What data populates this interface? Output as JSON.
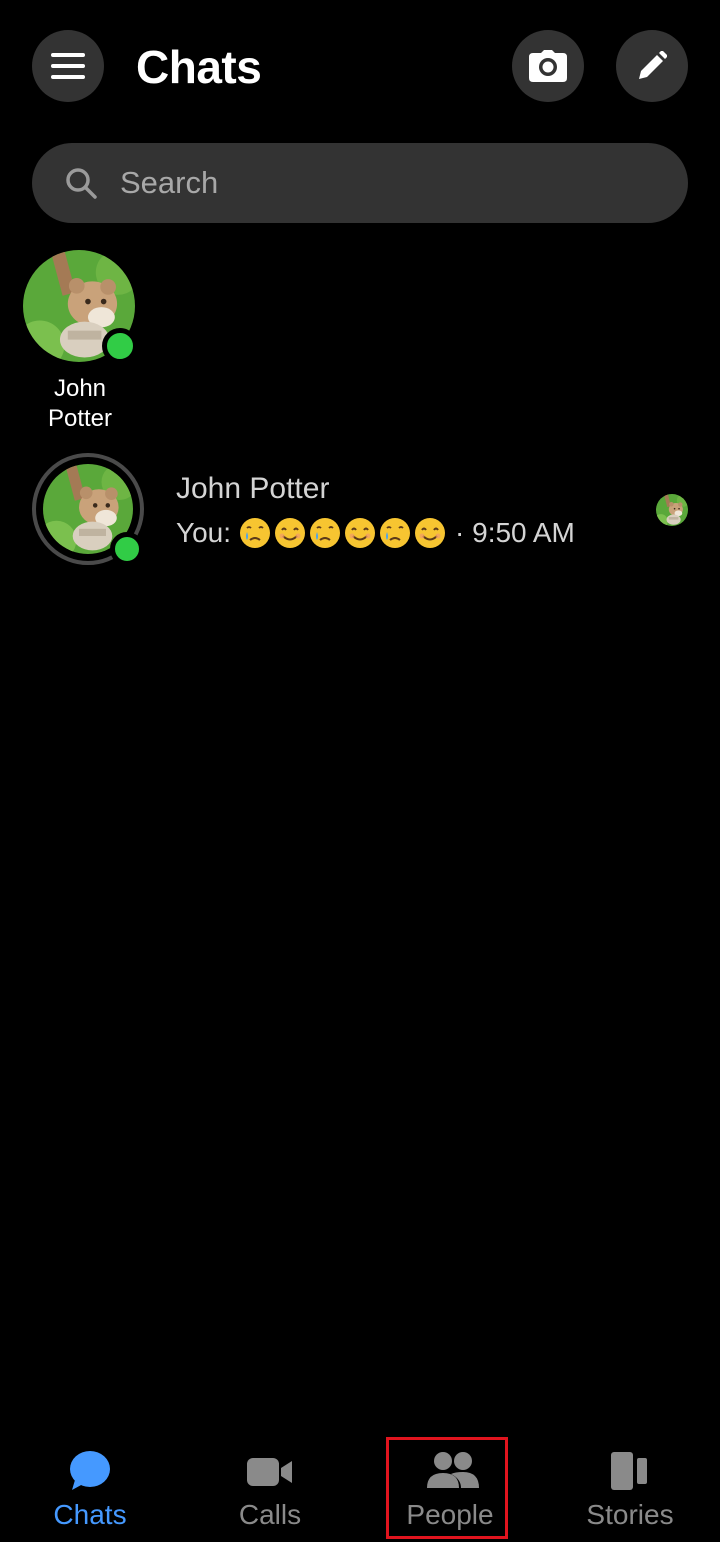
{
  "header": {
    "title": "Chats",
    "menu_icon": "hamburger-menu-icon",
    "camera_icon": "camera-icon",
    "compose_icon": "pencil-icon"
  },
  "search": {
    "placeholder": "Search"
  },
  "active_now": [
    {
      "name": "John Potter",
      "online": true
    }
  ],
  "conversations": [
    {
      "name": "John Potter",
      "preview_prefix": "You:",
      "emojis": [
        "crying-face",
        "smiling-face",
        "crying-face",
        "smiling-face",
        "crying-face",
        "smiling-face"
      ],
      "time": "· 9:50 AM",
      "online": true,
      "seen": true
    }
  ],
  "bottom_nav": {
    "items": [
      {
        "label": "Chats",
        "icon": "chat-bubble-icon",
        "active": true
      },
      {
        "label": "Calls",
        "icon": "video-camera-icon",
        "active": false
      },
      {
        "label": "People",
        "icon": "people-icon",
        "active": false
      },
      {
        "label": "Stories",
        "icon": "stories-icon",
        "active": false
      }
    ]
  },
  "colors": {
    "background": "#000000",
    "button_bg": "#333333",
    "accent": "#4599ff",
    "online": "#31cc46",
    "inactive_nav": "#8a8a8a",
    "highlight": "#e0141e"
  }
}
